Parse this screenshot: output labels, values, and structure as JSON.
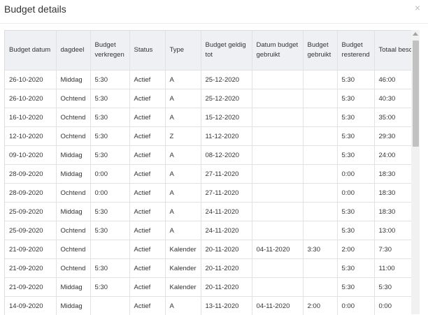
{
  "dialog": {
    "title": "Budget details",
    "close_glyph": "×"
  },
  "table": {
    "headers": [
      "Budget datum",
      "dagdeel",
      "Budget verkregen",
      "Status",
      "Type",
      "Budget geldig tot",
      "Datum budget gebruikt",
      "Budget gebruikt",
      "Budget resterend",
      "Totaal beschikbaar"
    ],
    "rows": [
      [
        "26-10-2020",
        "Middag",
        "5:30",
        "Actief",
        "A",
        "25-12-2020",
        "",
        "",
        "5:30",
        "46:00"
      ],
      [
        "26-10-2020",
        "Ochtend",
        "5:30",
        "Actief",
        "A",
        "25-12-2020",
        "",
        "",
        "5:30",
        "40:30"
      ],
      [
        "16-10-2020",
        "Ochtend",
        "5:30",
        "Actief",
        "A",
        "15-12-2020",
        "",
        "",
        "5:30",
        "35:00"
      ],
      [
        "12-10-2020",
        "Ochtend",
        "5:30",
        "Actief",
        "Z",
        "11-12-2020",
        "",
        "",
        "5:30",
        "29:30"
      ],
      [
        "09-10-2020",
        "Middag",
        "5:30",
        "Actief",
        "A",
        "08-12-2020",
        "",
        "",
        "5:30",
        "24:00"
      ],
      [
        "28-09-2020",
        "Middag",
        "0:00",
        "Actief",
        "A",
        "27-11-2020",
        "",
        "",
        "0:00",
        "18:30"
      ],
      [
        "28-09-2020",
        "Ochtend",
        "0:00",
        "Actief",
        "A",
        "27-11-2020",
        "",
        "",
        "0:00",
        "18:30"
      ],
      [
        "25-09-2020",
        "Middag",
        "5:30",
        "Actief",
        "A",
        "24-11-2020",
        "",
        "",
        "5:30",
        "18:30"
      ],
      [
        "25-09-2020",
        "Ochtend",
        "5:30",
        "Actief",
        "A",
        "24-11-2020",
        "",
        "",
        "5:30",
        "13:00"
      ],
      [
        "21-09-2020",
        "Ochtend",
        "",
        "Actief",
        "Kalender",
        "20-11-2020",
        "04-11-2020",
        "3:30",
        "2:00",
        "7:30"
      ],
      [
        "21-09-2020",
        "Ochtend",
        "5:30",
        "Actief",
        "Kalender",
        "20-11-2020",
        "",
        "",
        "5:30",
        "11:00"
      ],
      [
        "21-09-2020",
        "Middag",
        "5:30",
        "Actief",
        "Kalender",
        "20-11-2020",
        "",
        "",
        "5:30",
        "5:30"
      ],
      [
        "14-09-2020",
        "Middag",
        "",
        "Actief",
        "A",
        "13-11-2020",
        "04-11-2020",
        "2:00",
        "0:00",
        "0:00"
      ]
    ]
  },
  "icons": {
    "close": "close-icon",
    "scroll_up": "chevron-up-icon"
  }
}
